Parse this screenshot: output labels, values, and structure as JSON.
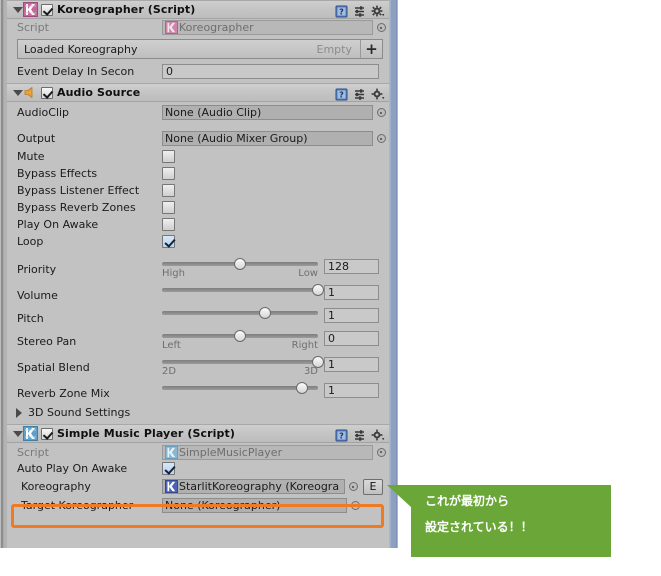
{
  "components": [
    {
      "id": "koreographer",
      "title": "Koreographer (Script)",
      "icon": "koreographer-script-icon",
      "enabled_checkbox": true,
      "expanded": true,
      "script_label": "Script",
      "script_value": "Koreographer",
      "list": {
        "title": "Loaded Koreography",
        "empty_label": "Empty",
        "add_label": "+"
      },
      "event_delay_label": "Event Delay In Secon",
      "event_delay_value": "0"
    },
    {
      "id": "audio-source",
      "title": "Audio Source",
      "icon": "audio-source-speaker-icon",
      "enabled_checkbox": true,
      "expanded": true,
      "fields": [
        {
          "label": "AudioClip",
          "value": "None (Audio Clip)",
          "type": "object"
        },
        {
          "label": "Output",
          "value": "None (Audio Mixer Group)",
          "type": "object"
        },
        {
          "label": "Mute",
          "value": false,
          "type": "checkbox"
        },
        {
          "label": "Bypass Effects",
          "value": false,
          "type": "checkbox"
        },
        {
          "label": "Bypass Listener Effect",
          "value": false,
          "type": "checkbox"
        },
        {
          "label": "Bypass Reverb Zones",
          "value": false,
          "type": "checkbox"
        },
        {
          "label": "Play On Awake",
          "value": false,
          "type": "checkbox"
        },
        {
          "label": "Loop",
          "value": true,
          "type": "checkbox"
        }
      ],
      "sliders": [
        {
          "label": "Priority",
          "value": "128",
          "percent": 50,
          "left_end": "High",
          "right_end": "Low"
        },
        {
          "label": "Volume",
          "value": "1",
          "percent": 100,
          "left_end": "",
          "right_end": ""
        },
        {
          "label": "Pitch",
          "value": "1",
          "percent": 66,
          "left_end": "",
          "right_end": ""
        },
        {
          "label": "Stereo Pan",
          "value": "0",
          "percent": 50,
          "left_end": "Left",
          "right_end": "Right"
        },
        {
          "label": "Spatial Blend",
          "value": "1",
          "percent": 100,
          "left_end": "2D",
          "right_end": "3D"
        },
        {
          "label": "Reverb Zone Mix",
          "value": "1",
          "percent": 90,
          "left_end": "",
          "right_end": ""
        }
      ],
      "foldout_3d": "3D Sound Settings"
    },
    {
      "id": "simple-music-player",
      "title": "Simple Music Player (Script)",
      "icon": "simple-music-player-script-icon",
      "enabled_checkbox": true,
      "expanded": true,
      "script_label": "Script",
      "script_value": "SimpleMusicPlayer",
      "fields": [
        {
          "label": "Auto Play On Awake",
          "value": true,
          "type": "checkbox"
        },
        {
          "label": "Koreography",
          "value": "StarlitKoreography (Koreogra",
          "type": "object",
          "highlighted": true,
          "extra_button": "E"
        },
        {
          "label": "Target Koreographer",
          "value": "None (Koreographer)",
          "type": "object"
        }
      ]
    }
  ],
  "header_icons": {
    "help": "help-book-icon",
    "preset": "preset-sliders-icon",
    "settings": "gear-dropdown-icon"
  },
  "callout": {
    "line1": "これが最初から",
    "line2": "設定されている！！",
    "color": "#6aa738"
  },
  "colors": {
    "panel_bg": "#c2c2c2",
    "highlight": "#ef7a21",
    "callout_green": "#6aa738",
    "scrollbar": "#8da0bf"
  }
}
